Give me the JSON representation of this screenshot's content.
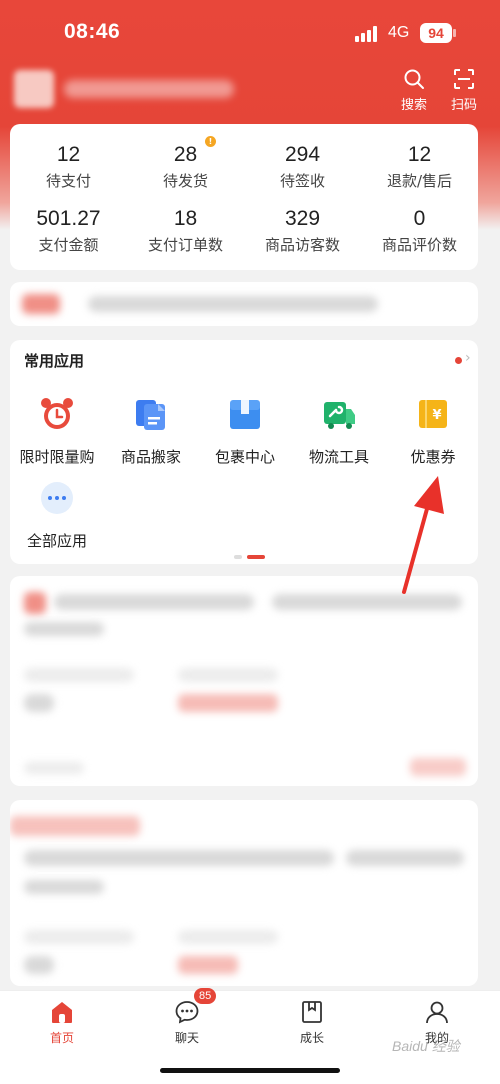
{
  "status_bar": {
    "time": "08:46",
    "network": "4G",
    "battery": "94"
  },
  "header": {
    "search_label": "搜索",
    "scan_label": "扫码"
  },
  "stats": [
    {
      "value": "12",
      "label": "待支付"
    },
    {
      "value": "28",
      "label": "待发货",
      "badge": "!"
    },
    {
      "value": "294",
      "label": "待签收"
    },
    {
      "value": "12",
      "label": "退款/售后"
    },
    {
      "value": "501.27",
      "label": "支付金额"
    },
    {
      "value": "18",
      "label": "支付订单数"
    },
    {
      "value": "329",
      "label": "商品访客数"
    },
    {
      "value": "0",
      "label": "商品评价数"
    }
  ],
  "apps": {
    "title": "常用应用",
    "items": [
      {
        "label": "限时限量购",
        "icon": "alarm-clock-icon"
      },
      {
        "label": "商品搬家",
        "icon": "documents-icon"
      },
      {
        "label": "包裹中心",
        "icon": "package-box-icon"
      },
      {
        "label": "物流工具",
        "icon": "truck-wrench-icon"
      },
      {
        "label": "优惠券",
        "icon": "coupon-icon"
      },
      {
        "label": "全部应用",
        "icon": "more-dots-icon"
      }
    ]
  },
  "tabbar": {
    "items": [
      {
        "label": "首页",
        "icon": "home-icon",
        "active": true
      },
      {
        "label": "聊天",
        "icon": "chat-icon",
        "badge": "85"
      },
      {
        "label": "成长",
        "icon": "book-icon"
      },
      {
        "label": "我的",
        "icon": "person-icon"
      }
    ]
  },
  "watermark": "Baidu 经验",
  "colors": {
    "brand": "#e54538",
    "badge_orange": "#f5a623",
    "arrow": "#e8312a"
  }
}
